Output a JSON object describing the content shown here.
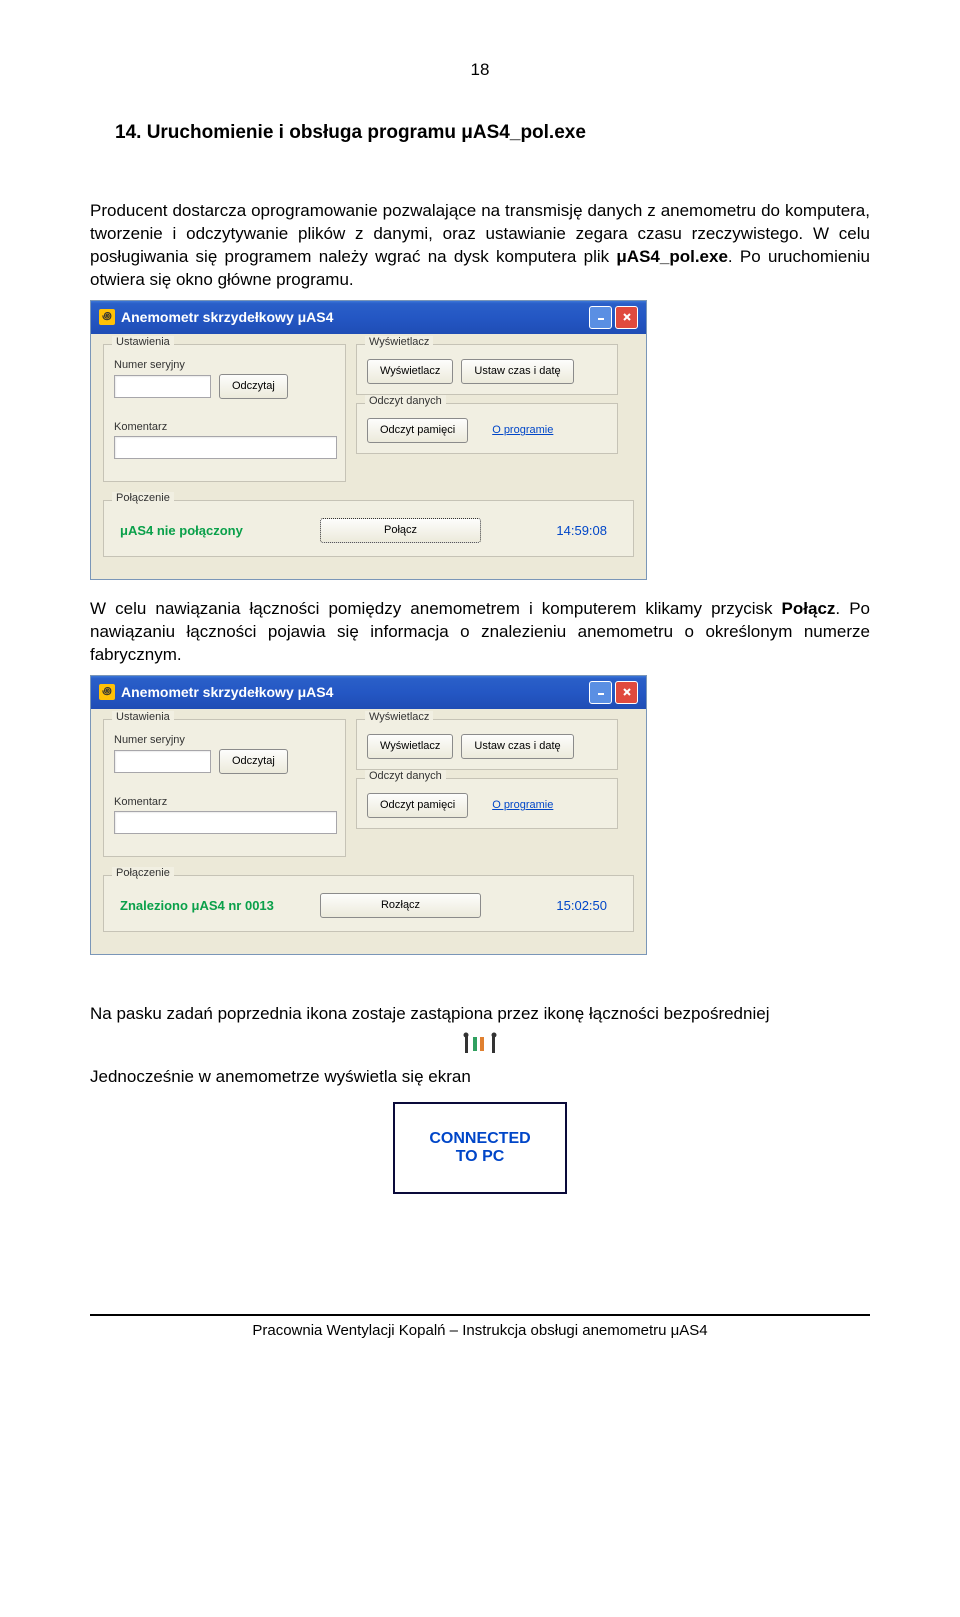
{
  "page_number": "18",
  "section_title": "14.   Uruchomienie i obsługa programu μAS4_pol.exe",
  "para1": "Producent dostarcza oprogramowanie pozwalające na transmisję danych z anemometru do komputera, tworzenie i odczytywanie plików z danymi, oraz ustawianie zegara czasu rzeczywistego. W celu posługiwania się programem należy wgrać na dysk komputera plik ",
  "para1_bold": "μAS4_pol.exe",
  "para1_cont": ". Po uruchomieniu otwiera się okno główne programu.",
  "window": {
    "title": "Anemometr skrzydełkowy μAS4",
    "group_ustawienia": "Ustawienia",
    "label_numer": "Numer seryjny",
    "btn_odczytaj": "Odczytaj",
    "label_komentarz": "Komentarz",
    "group_wyswietlacz": "Wyświetlacz",
    "btn_wyswietlacz": "Wyświetlacz",
    "btn_ustaw": "Ustaw czas i datę",
    "group_odczyt": "Odczyt danych",
    "btn_odczyt": "Odczyt pamięci",
    "link_oprogramie": "O programie",
    "group_polaczenie": "Połączenie"
  },
  "status1": {
    "text": "μAS4 nie połączony",
    "btn": "Połącz",
    "time": "14:59:08"
  },
  "para2_a": "W celu nawiązania łączności pomiędzy anemometrem i komputerem klikamy przycisk ",
  "para2_bold": "Połącz",
  "para2_b": ". Po nawiązaniu łączności pojawia się informacja o znalezieniu anemometru o określonym numerze fabrycznym.",
  "status2": {
    "text": "Znaleziono μAS4 nr 0013",
    "btn": "Rozłącz",
    "time": "15:02:50"
  },
  "para3": "Na pasku zadań poprzednia ikona zostaje zastąpiona przez ikonę łączności bezpośredniej",
  "para4": "Jednocześnie w anemometrze wyświetla się ekran",
  "small_box_line1": "CONNECTED",
  "small_box_line2": "TO PC",
  "footer": "Pracownia Wentylacji Kopalń – Instrukcja obsługi anemometru μAS4"
}
